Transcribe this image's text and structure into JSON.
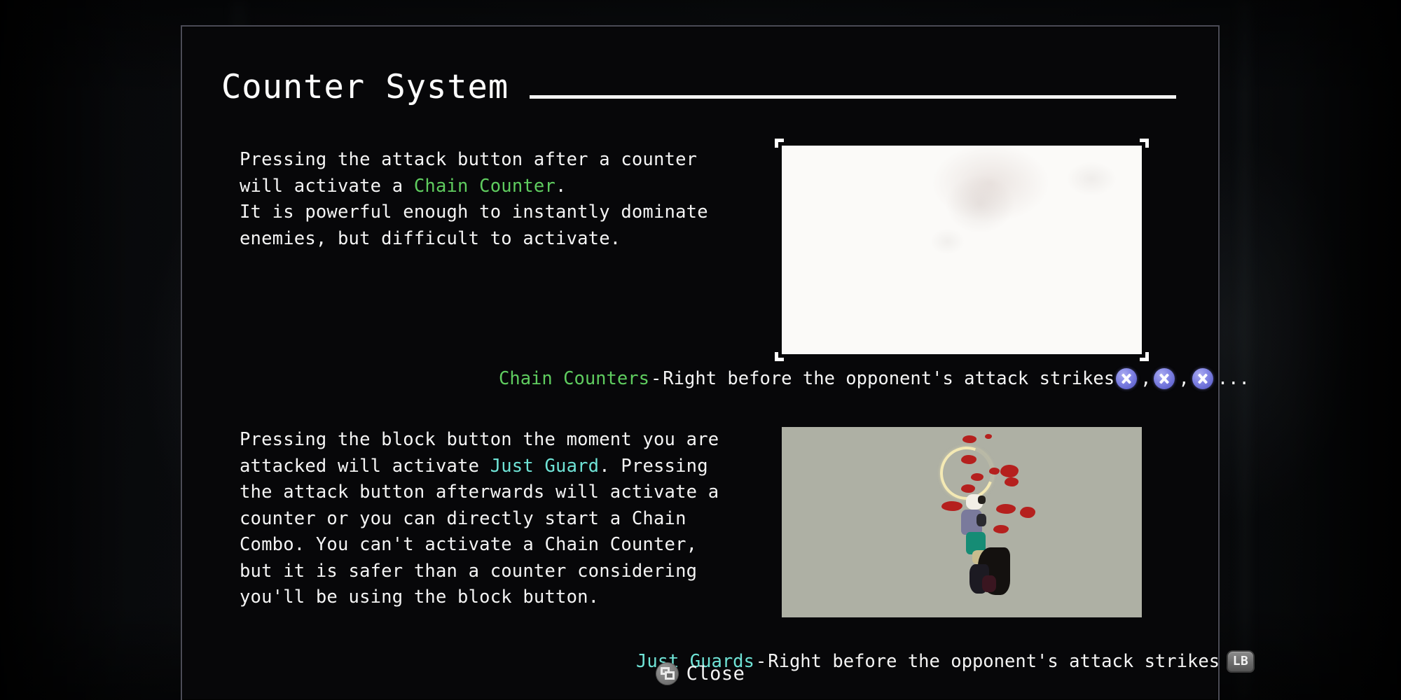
{
  "dialog": {
    "title": "Counter System"
  },
  "sections": [
    {
      "id": "chain-counter",
      "paragraph_prefix": "Pressing the attack button after a counter\nwill activate a ",
      "keyword": "Chain Counter",
      "paragraph_suffix": ".\nIt is powerful enough to instantly dominate\nenemies, but difficult to activate.",
      "caption_keyword": "Chain Counters",
      "caption_separator": "-",
      "caption_text": "Right before the opponent's attack strikes",
      "caption_buttons": [
        "X",
        "X",
        "X"
      ],
      "caption_button_separator": ",",
      "caption_trailing": "...",
      "keyword_color": "#5fcc5f",
      "media_label": "chain-counter-clip"
    },
    {
      "id": "just-guard",
      "paragraph_prefix": "Pressing the block button the moment you are\nattacked will activate ",
      "keyword": "Just Guard",
      "paragraph_suffix": ". Pressing\nthe attack button afterwards will activate a\ncounter or you can directly start a Chain\nCombo. You can't activate a Chain Counter,\nbut it is safer than a counter considering\nyou'll be using the block button.",
      "caption_keyword": "Just Guards",
      "caption_separator": "-",
      "caption_text": "Right before the opponent's attack strikes",
      "caption_buttons": [
        "LB"
      ],
      "keyword_color": "#6fe3d6",
      "media_label": "just-guard-clip"
    }
  ],
  "footer": {
    "close_label": "Close",
    "close_icon": "overlapping-squares-icon"
  },
  "colors": {
    "text": "#f4f4f4",
    "green_accent": "#5fcc5f",
    "cyan_accent": "#6fe3d6",
    "button_blue": "#8184e4",
    "dialog_border": "#4b4b56",
    "dialog_bg": "#070709",
    "panel2_bg": "#aeb0a4"
  }
}
